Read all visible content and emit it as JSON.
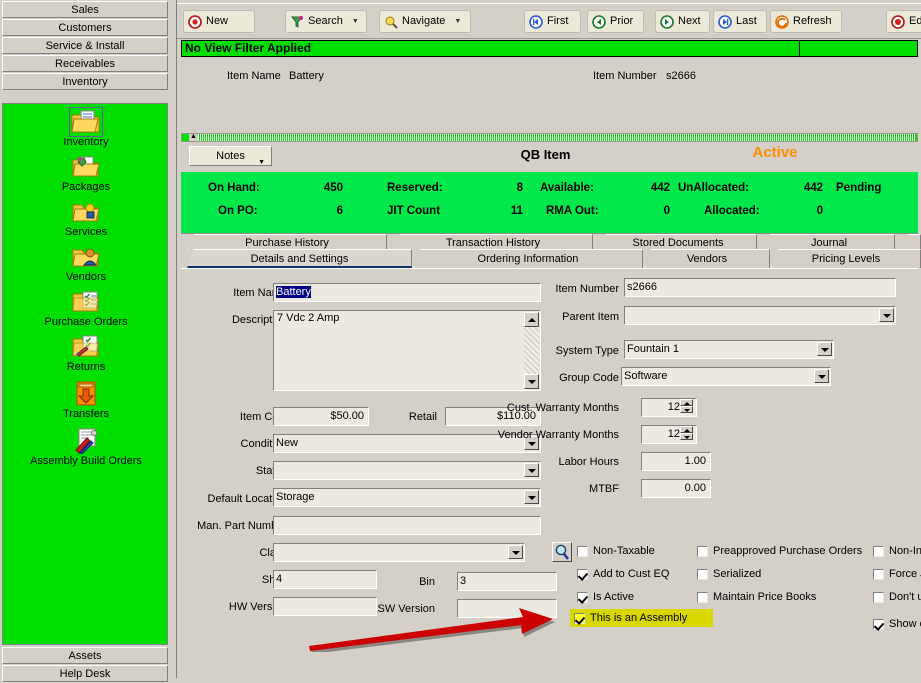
{
  "sidebar": {
    "top_modules": [
      "Sales",
      "Customers",
      "Service & Install",
      "Receivables",
      "Inventory"
    ],
    "bottom_modules": [
      "Assets",
      "Help Desk"
    ],
    "icons": [
      {
        "label": "Inventory",
        "icon": "folder-document-icon",
        "selected": true
      },
      {
        "label": "Packages",
        "icon": "folder-package-icon",
        "selected": false
      },
      {
        "label": "Services",
        "icon": "folder-service-icon",
        "selected": false
      },
      {
        "label": "Vendors",
        "icon": "folder-person-icon",
        "selected": false
      },
      {
        "label": "Purchase Orders",
        "icon": "folder-checklist-icon",
        "selected": false
      },
      {
        "label": "Returns",
        "icon": "folder-return-icon",
        "selected": false
      },
      {
        "label": "Transfers",
        "icon": "down-arrow-transfer-icon",
        "selected": false
      },
      {
        "label": "Assembly Build Orders",
        "icon": "assembly-tools-icon",
        "selected": false
      }
    ]
  },
  "toolbar": {
    "new": "New",
    "search": "Search",
    "navigate": "Navigate",
    "first": "First",
    "prior": "Prior",
    "next": "Next",
    "last": "Last",
    "refresh": "Refresh",
    "edit": "Edi"
  },
  "filter_bar": {
    "text": "No View Filter Applied"
  },
  "record_header": {
    "item_name_label": "Item Name",
    "item_name_value": "Battery",
    "item_number_label": "Item Number",
    "item_number_value": "s2666"
  },
  "panel": {
    "notes_button": "Notes",
    "title": "QB Item",
    "status": "Active",
    "status_color": "#ff8c00"
  },
  "summary": {
    "row1": [
      {
        "label": "On Hand:",
        "value": "450"
      },
      {
        "label": "Reserved:",
        "value": "8"
      },
      {
        "label": "Available:",
        "value": "442"
      },
      {
        "label": "UnAllocated:",
        "value": "442"
      },
      {
        "label": "Pending",
        "value": ""
      }
    ],
    "row2": [
      {
        "label": "On PO:",
        "value": "6"
      },
      {
        "label": "JIT Count",
        "value": "11"
      },
      {
        "label": "RMA Out:",
        "value": "0"
      },
      {
        "label": "Allocated:",
        "value": "0"
      }
    ]
  },
  "tabs": {
    "back_row": [
      "Purchase History",
      "Transaction History",
      "Stored Documents",
      "Journal"
    ],
    "front_row": [
      "Details and Settings",
      "Ordering Information",
      "Vendors",
      "Pricing Levels"
    ],
    "active": "Details and Settings"
  },
  "form": {
    "left": {
      "item_name_label": "Item Name",
      "item_name_value": "Battery",
      "description_label": "Description",
      "description_value": "7 Vdc 2 Amp",
      "item_cost_label": "Item Cost",
      "item_cost_value": "$50.00",
      "retail_label": "Retail",
      "retail_value": "$110.00",
      "condition_label": "Condition",
      "condition_value": "New",
      "status_label": "Status",
      "status_value": "",
      "default_location_label": "Default Location",
      "default_location_value": "Storage",
      "man_part_number_label": "Man. Part Number",
      "man_part_number_value": "",
      "class_label": "Class",
      "class_value": "",
      "shelf_label": "Shelf",
      "shelf_value": "4",
      "bin_label": "Bin",
      "bin_value": "3",
      "hw_version_label": "HW Version",
      "hw_version_value": "",
      "sw_version_label": "SW Version",
      "sw_version_value": ""
    },
    "right": {
      "item_number_label": "Item Number",
      "item_number_value": "s2666",
      "parent_item_label": "Parent Item",
      "parent_item_value": "",
      "system_type_label": "System Type",
      "system_type_value": "Fountain 1",
      "group_code_label": "Group Code",
      "group_code_value": "Software",
      "cust_warranty_label": "Cust. Warranty Months",
      "cust_warranty_value": "12",
      "vendor_warranty_label": "Vendor Warranty Months",
      "vendor_warranty_value": "12",
      "labor_hours_label": "Labor Hours",
      "labor_hours_value": "1.00",
      "mtbf_label": "MTBF",
      "mtbf_value": "0.00"
    },
    "checkboxes_col1": [
      {
        "label": "Non-Taxable",
        "checked": false,
        "highlight": false
      },
      {
        "label": "Add to Cust EQ",
        "checked": true,
        "highlight": false
      },
      {
        "label": "Is Active",
        "checked": true,
        "highlight": false
      },
      {
        "label": "This is an Assembly",
        "checked": true,
        "highlight": true
      }
    ],
    "checkboxes_col2": [
      {
        "label": "Preapproved Purchase Orders",
        "checked": false,
        "highlight": false
      },
      {
        "label": "Serialized",
        "checked": false,
        "highlight": false
      },
      {
        "label": "Maintain Price Books",
        "checked": false,
        "highlight": false
      }
    ],
    "checkboxes_col3": [
      {
        "label": "Non-Inv",
        "checked": false,
        "highlight": false
      },
      {
        "label": "Force J",
        "checked": false,
        "highlight": false
      },
      {
        "label": "Don't up",
        "checked": false,
        "highlight": false
      },
      {
        "label": "Show o",
        "checked": true,
        "highlight": false
      }
    ]
  },
  "annotation": {
    "arrow_color": "#cc0000"
  }
}
